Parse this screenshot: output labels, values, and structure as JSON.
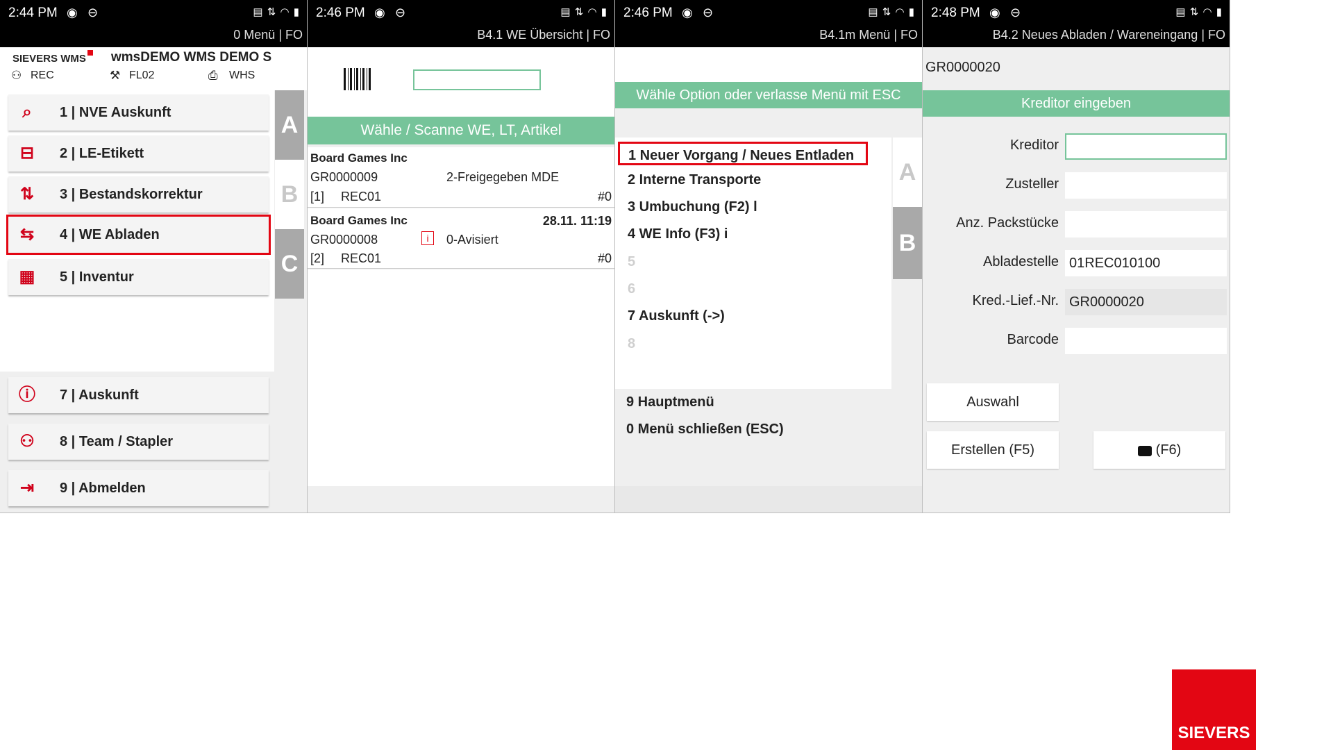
{
  "screen1": {
    "time": "2:44 PM",
    "subtitle": "0 Menü | FO",
    "brand": "SIEVERS WMS",
    "title": "wmsDEMO WMS DEMO S",
    "info": [
      "REC",
      "FL02",
      "WHS"
    ],
    "menu": [
      {
        "label": "1 | NVE Auskunft",
        "icon": "search-label-icon"
      },
      {
        "label": "2 | LE-Etikett",
        "icon": "label-icon"
      },
      {
        "label": "3 | Bestandskorrektur",
        "icon": "updown-icon"
      },
      {
        "label": "4 | WE Abladen",
        "icon": "truck-icon"
      },
      {
        "label": "5 | Inventur",
        "icon": "grid-icon"
      }
    ],
    "bottom_menu": [
      {
        "label": "7 | Auskunft",
        "icon": "info-icon"
      },
      {
        "label": "8 | Team / Stapler",
        "icon": "team-icon"
      },
      {
        "label": "9 | Abmelden",
        "icon": "logout-icon"
      }
    ],
    "tabs": [
      "A",
      "B",
      "C"
    ]
  },
  "screen2": {
    "time": "2:46 PM",
    "subtitle": "B4.1 WE Übersicht | FO",
    "prompt": "Wähle / Scanne WE, LT, Artikel",
    "scan_value": "",
    "items": [
      {
        "company": "Board Games Inc",
        "date": "",
        "id": "GR0000009",
        "status": "2-Freigegeben MDE",
        "pos": "[1]",
        "loc": "REC01",
        "num": "#0"
      },
      {
        "company": "Board Games Inc",
        "date": "28.11. 11:19",
        "id": "GR0000008",
        "status": "0-Avisiert",
        "pos": "[2]",
        "loc": "REC01",
        "num": "#0"
      }
    ]
  },
  "screen3": {
    "time": "2:46 PM",
    "subtitle": "B4.1m Menü | FO",
    "prompt": "Wähle Option oder verlasse Menü mit ESC",
    "options": [
      "1 Neuer Vorgang / Neues Entladen",
      "2 Interne Transporte",
      "3 Umbuchung (F2) l",
      "4 WE Info (F3) i",
      "5",
      "6",
      "7 Auskunft (->)",
      "8"
    ],
    "footer": [
      "9 Hauptmenü",
      "0 Menü schließen (ESC)"
    ],
    "tabs": [
      "A",
      "B"
    ]
  },
  "screen4": {
    "time": "2:48 PM",
    "subtitle": "B4.2 Neues Abladen / Wareneingang | FO",
    "doc_id": "GR0000020",
    "section": "Kreditor eingeben",
    "fields": [
      {
        "label": "Kreditor",
        "value": ""
      },
      {
        "label": "Zusteller",
        "value": ""
      },
      {
        "label": "Anz. Packstücke",
        "value": ""
      },
      {
        "label": "Abladestelle",
        "value": "01REC010100"
      },
      {
        "label": "Kred.-Lief.-Nr.",
        "value": "GR0000020"
      },
      {
        "label": "Barcode",
        "value": ""
      }
    ],
    "buttons": {
      "select": "Auswahl",
      "create": "Erstellen (F5)",
      "camera": "(F6)"
    }
  },
  "logo_text": "SIEVERS",
  "colors": {
    "accent_red": "#e30613",
    "green": "#76c49a",
    "tab_gray": "#a9a9a9"
  }
}
